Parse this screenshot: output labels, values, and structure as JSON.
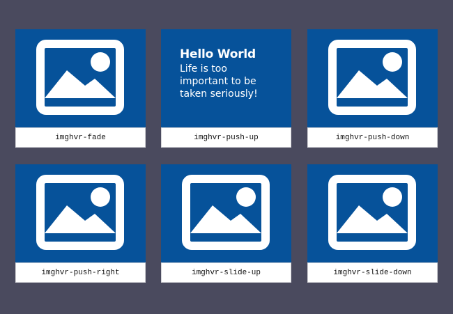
{
  "colors": {
    "background": "#4a4a5e",
    "tile": "#06529a",
    "caption_bg": "#ffffff",
    "icon": "#ffffff"
  },
  "cards": [
    {
      "caption": "imghvr-fade",
      "icon": "image-placeholder-icon"
    },
    {
      "caption": "imghvr-push-up",
      "hover": {
        "heading": "Hello World",
        "text": "Life is too important to be taken seriously!"
      }
    },
    {
      "caption": "imghvr-push-down",
      "icon": "image-placeholder-icon"
    },
    {
      "caption": "imghvr-push-right",
      "icon": "image-placeholder-icon"
    },
    {
      "caption": "imghvr-slide-up",
      "icon": "image-placeholder-icon"
    },
    {
      "caption": "imghvr-slide-down",
      "icon": "image-placeholder-icon"
    }
  ]
}
